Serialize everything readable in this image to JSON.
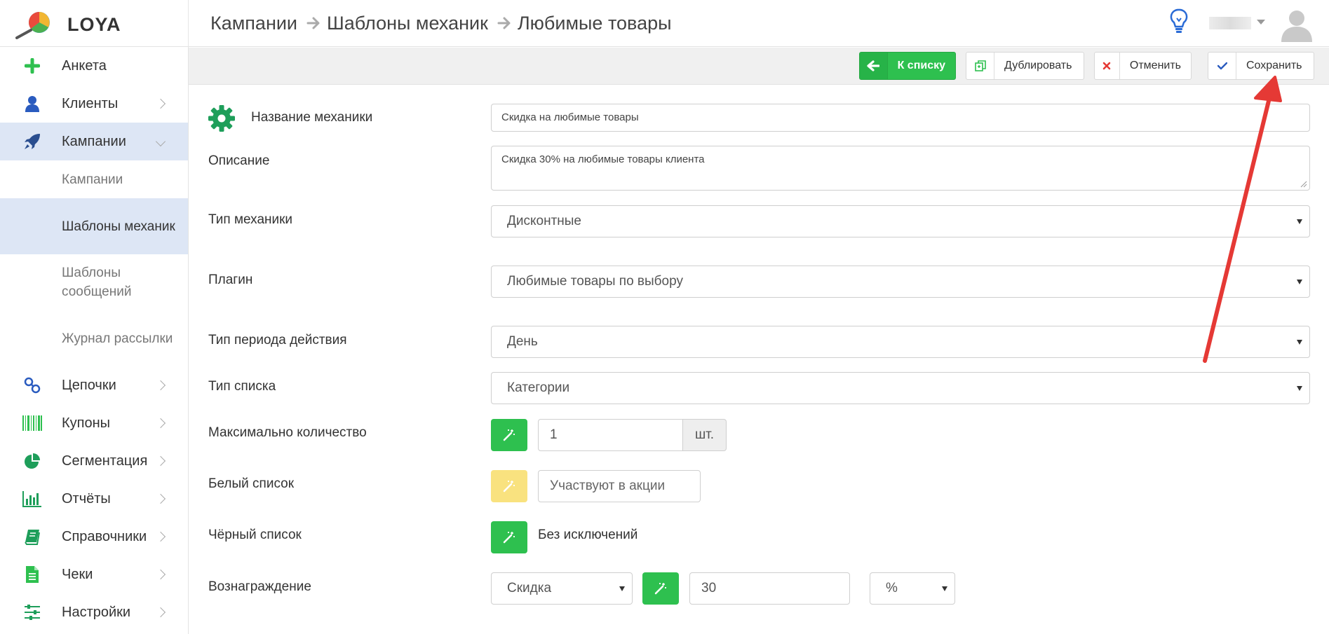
{
  "app": {
    "logo_text": "LOYA"
  },
  "header": {
    "breadcrumb": [
      "Кампании",
      "Шаблоны механик",
      "Любимые товары"
    ]
  },
  "sidebar": {
    "items": [
      {
        "label": "Анкета",
        "icon": "plus-icon"
      },
      {
        "label": "Клиенты",
        "icon": "user-icon"
      },
      {
        "label": "Кампании",
        "icon": "rocket-icon"
      },
      {
        "label": "Цепочки",
        "icon": "link-icon"
      },
      {
        "label": "Купоны",
        "icon": "barcode-icon"
      },
      {
        "label": "Сегментация",
        "icon": "pie-chart-icon"
      },
      {
        "label": "Отчёты",
        "icon": "bar-chart-icon"
      },
      {
        "label": "Справочники",
        "icon": "book-icon"
      },
      {
        "label": "Чеки",
        "icon": "receipt-icon"
      },
      {
        "label": "Настройки",
        "icon": "sliders-icon"
      }
    ],
    "sub_items": [
      "Кампании",
      "Шаблоны механик",
      "Шаблоны сообщений",
      "Журнал рассылки"
    ]
  },
  "toolbar": {
    "back_label": "К списку",
    "duplicate_label": "Дублировать",
    "cancel_label": "Отменить",
    "save_label": "Сохранить"
  },
  "form": {
    "name_label": "Название механики",
    "name_value": "Скидка на любимые товары",
    "description_label": "Описание",
    "description_value": "Скидка 30% на любимые товары клиента",
    "mechanic_type_label": "Тип механики",
    "mechanic_type_value": "Дисконтные",
    "plugin_label": "Плагин",
    "plugin_value": "Любимые товары по выбору",
    "period_type_label": "Тип периода действия",
    "period_type_value": "День",
    "list_type_label": "Тип списка",
    "list_type_value": "Категории",
    "max_qty_label": "Максимально количество",
    "max_qty_value": "1",
    "max_qty_unit": "шт.",
    "whitelist_label": "Белый список",
    "whitelist_placeholder": "Участвуют в акции",
    "blacklist_label": "Чёрный список",
    "blacklist_value": "Без исключений",
    "reward_label": "Вознаграждение",
    "reward_type_value": "Скидка",
    "reward_amount_value": "30",
    "reward_unit_value": "%"
  },
  "colors": {
    "accent_green": "#2ec04f",
    "active_nav_bg": "#dde6f5",
    "annotation_arrow": "#e53935",
    "wand_yellow": "#f9e27f"
  }
}
